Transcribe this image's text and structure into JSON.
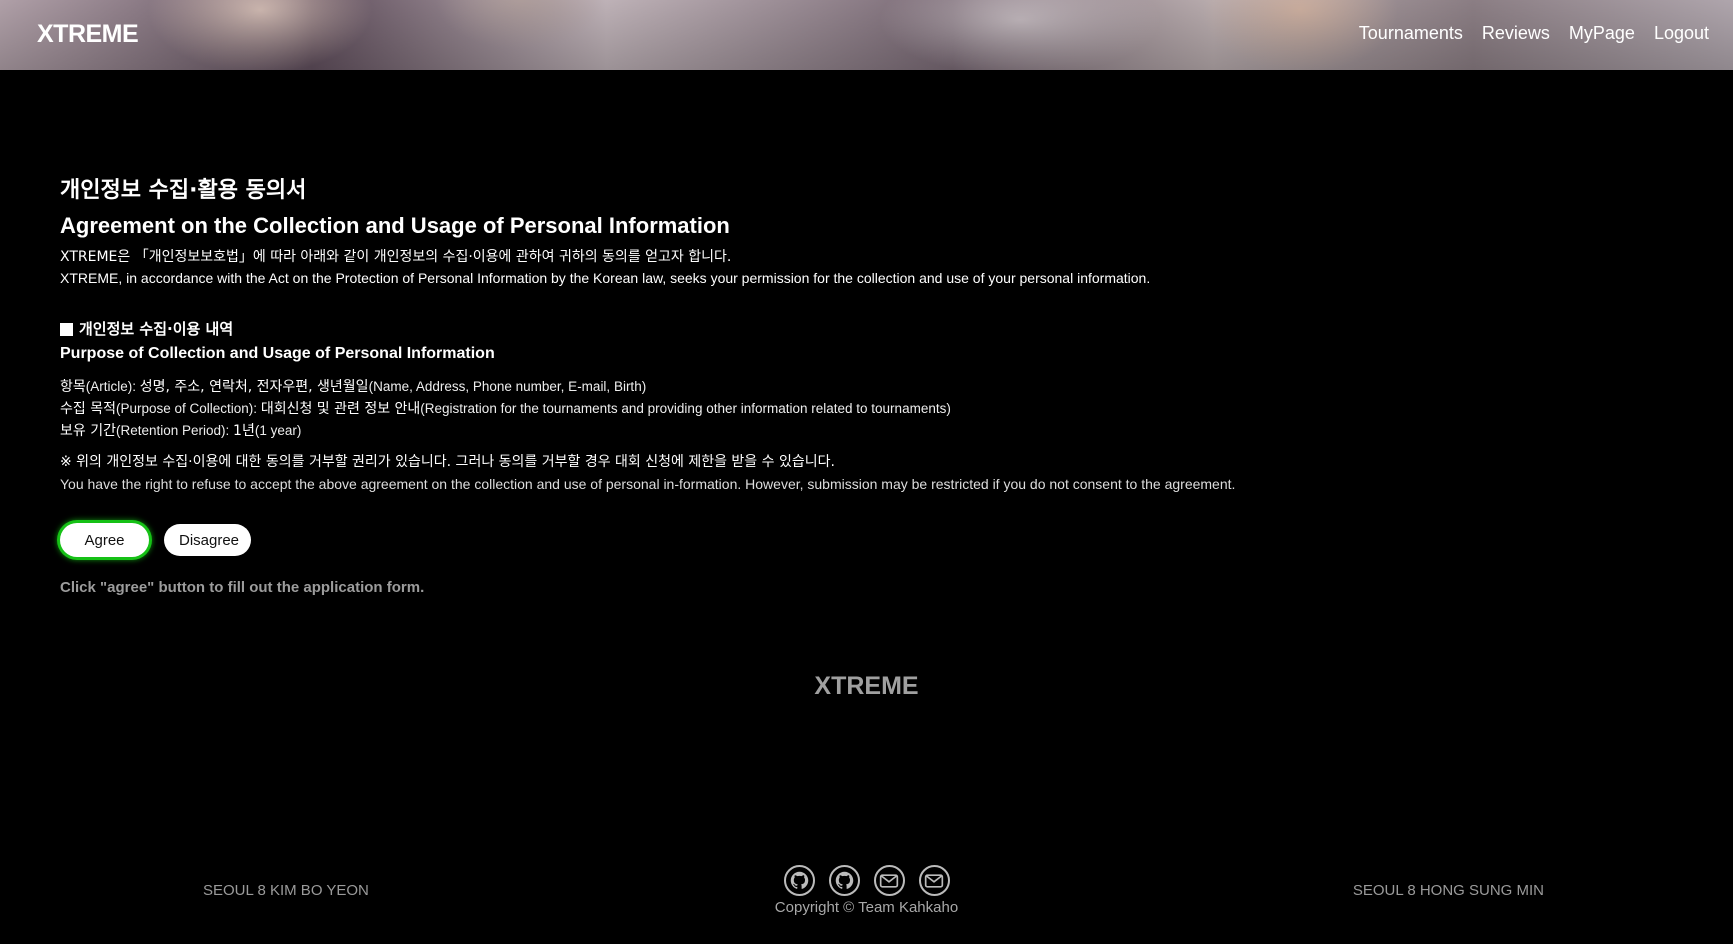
{
  "header": {
    "logo": "XTREME",
    "nav": [
      "Tournaments",
      "Reviews",
      "MyPage",
      "Logout"
    ]
  },
  "agreement": {
    "title_ko": "개인정보 수집·활용 동의서",
    "title_en": "Agreement on the Collection and Usage of Personal Information",
    "intro_ko": "XTREME은 「개인정보보호법」에 따라 아래와 같이 개인정보의 수집·이용에 관하여 귀하의 동의를 얻고자 합니다.",
    "intro_en": "XTREME, in accordance with the Act on the Protection of Personal Information by the Korean law, seeks your permission for the collection and use of your personal information.",
    "section_ko": "개인정보 수집·이용 내역",
    "section_en": "Purpose of Collection and Usage of Personal Information",
    "items": [
      {
        "ko1": "항목",
        "en1": "(Article): ",
        "ko2": "성명, 주소, 연락처, 전자우편, 생년월일",
        "en2": "(Name, Address, Phone number, E-mail, Birth)"
      },
      {
        "ko1": "수집 목적",
        "en1": "(Purpose of Collection): ",
        "ko2": "대회신청 및 관련 정보 안내",
        "en2": "(Registration for the tournaments and providing other information related to tournaments)"
      },
      {
        "ko1": "보유 기간",
        "en1": "(Retention Period): ",
        "ko2": "1년",
        "en2": "(1 year)"
      }
    ],
    "notice_ko": "※ 위의 개인정보 수집·이용에 대한 동의를 거부할 권리가 있습니다. 그러나 동의를 거부할 경우 대회 신청에 제한을 받을 수 있습니다.",
    "notice_en": "You have the right to refuse to accept the above agreement on the collection and use of personal in-formation. However, submission may be restricted if you do not consent to the agreement.",
    "agree_label": "Agree",
    "disagree_label": "Disagree",
    "hint": "Click \"agree\" button to fill out the application form."
  },
  "footer": {
    "logo": "XTREME",
    "left": "SEOUL 8 KIM BO YEON",
    "right": "SEOUL 8 HONG SUNG MIN",
    "copyright": "Copyright © Team Kahkaho",
    "icons": [
      "github-icon",
      "github-icon",
      "mail-icon",
      "mail-icon"
    ]
  },
  "colors": {
    "background": "#000000",
    "agree_glow": "#16c116",
    "muted_text": "#9c9c9c"
  }
}
